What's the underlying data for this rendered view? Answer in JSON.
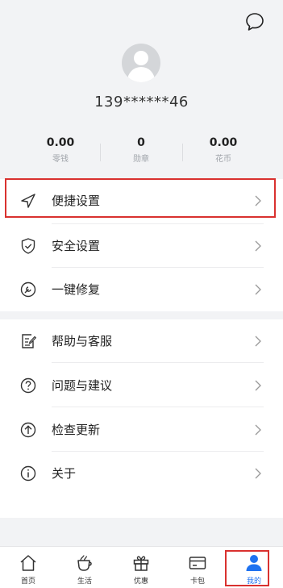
{
  "profile": {
    "phone": "139******46"
  },
  "stats": [
    {
      "value": "0.00",
      "label": "零钱"
    },
    {
      "value": "0",
      "label": "勋章"
    },
    {
      "value": "0.00",
      "label": "花币"
    }
  ],
  "menu_group1": [
    {
      "label": "便捷设置",
      "icon": "send-icon",
      "highlighted": true
    },
    {
      "label": "安全设置",
      "icon": "shield-check-icon"
    },
    {
      "label": "一键修复",
      "icon": "repair-icon"
    }
  ],
  "menu_group2": [
    {
      "label": "帮助与客服",
      "icon": "help-edit-icon"
    },
    {
      "label": "问题与建议",
      "icon": "question-icon"
    },
    {
      "label": "检查更新",
      "icon": "update-arrow-icon"
    },
    {
      "label": "关于",
      "icon": "info-icon"
    }
  ],
  "tabs": [
    {
      "label": "首页",
      "icon": "home-icon"
    },
    {
      "label": "生活",
      "icon": "cup-icon"
    },
    {
      "label": "优惠",
      "icon": "gift-icon"
    },
    {
      "label": "卡包",
      "icon": "card-icon"
    },
    {
      "label": "我的",
      "icon": "person-icon",
      "active": true
    }
  ],
  "colors": {
    "accent": "#1f72f0",
    "highlight_border": "#d9312f",
    "background": "#f2f3f5"
  }
}
